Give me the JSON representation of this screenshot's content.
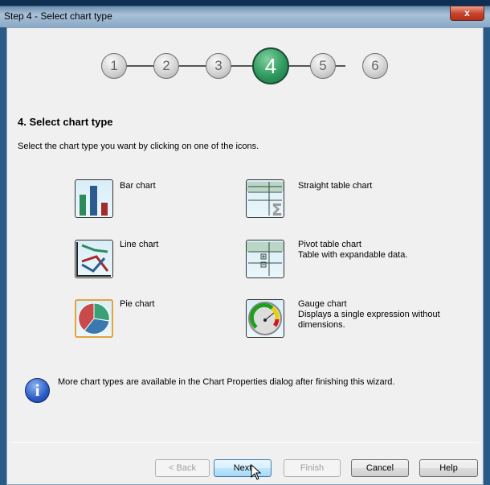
{
  "window": {
    "title": "Step 4 - Select chart type",
    "close_label": "x"
  },
  "steps": {
    "items": [
      "1",
      "2",
      "3",
      "4",
      "5",
      "6"
    ],
    "current": 4,
    "active_color": "#2e9a5e"
  },
  "heading": "4. Select chart type",
  "instruction": "Select the chart type you want by clicking on one of the icons.",
  "chart_types": [
    {
      "label": "Bar chart",
      "description": "",
      "icon": "bar-chart-icon"
    },
    {
      "label": "Straight table chart",
      "description": "",
      "icon": "straight-table-icon"
    },
    {
      "label": "Line chart",
      "description": "",
      "icon": "line-chart-icon"
    },
    {
      "label": "Pivot table chart",
      "description": "Table with expandable data.",
      "icon": "pivot-table-icon"
    },
    {
      "label": "Pie chart",
      "description": "",
      "icon": "pie-chart-icon",
      "selected": true
    },
    {
      "label": "Gauge chart",
      "description": "Displays a single expression without dimensions.",
      "icon": "gauge-chart-icon"
    }
  ],
  "info_text": "More chart types are available in the Chart Properties dialog after finishing this wizard.",
  "buttons": {
    "back": "< Back",
    "next": "Next",
    "finish": "Finish",
    "cancel": "Cancel",
    "help": "Help"
  }
}
